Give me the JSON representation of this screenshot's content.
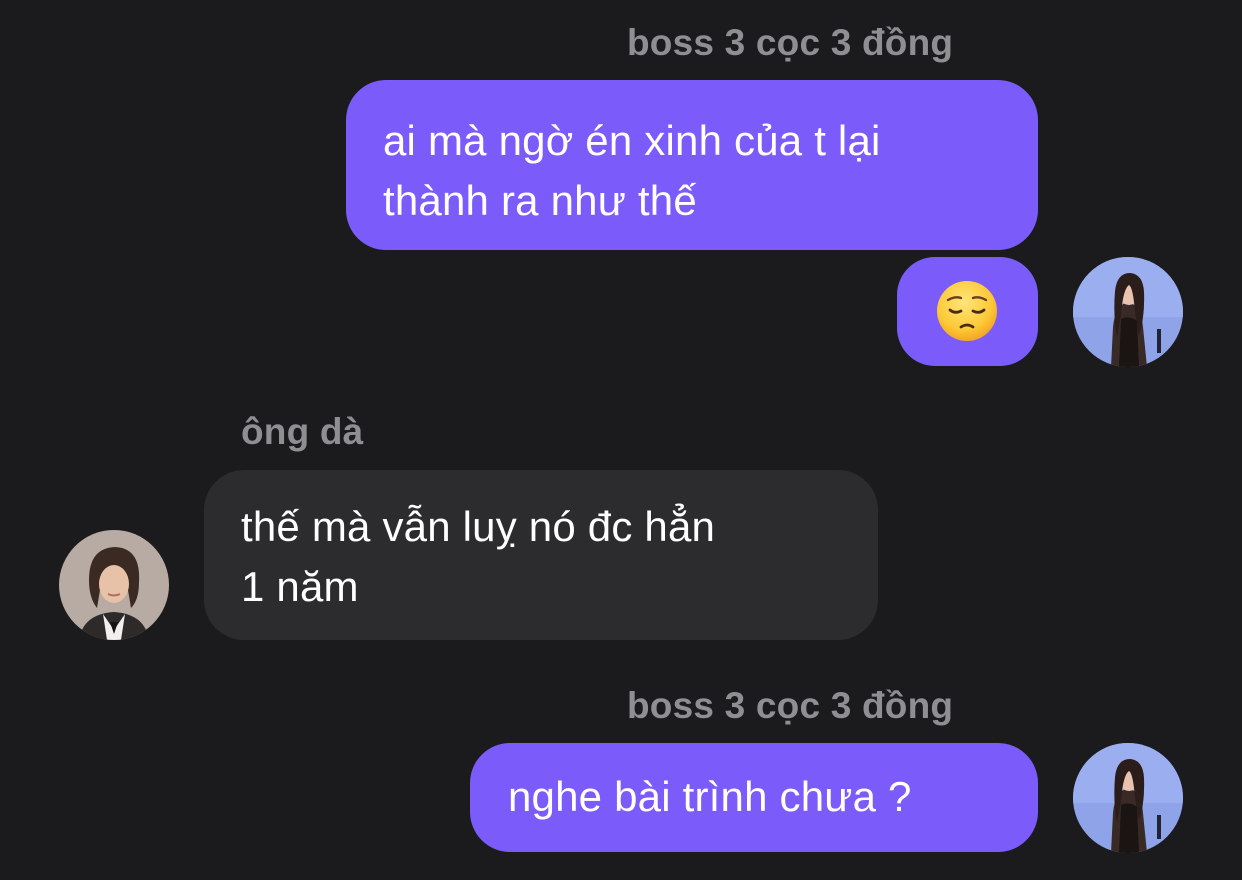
{
  "messages": [
    {
      "sender": "boss 3 cọc 3 đồng",
      "lines": [
        "ai mà ngờ én xinh của t lại",
        "thành ra như thế"
      ]
    },
    {
      "emoji": "pensive-face"
    },
    {
      "sender": "ông dà",
      "lines": [
        "thế mà vẫn luỵ nó đc hẳn",
        "1 năm"
      ]
    },
    {
      "sender": "boss 3 cọc 3 đồng",
      "lines": [
        "nghe bài trình chưa ?"
      ]
    }
  ],
  "colors": {
    "background": "#1b1b1d",
    "outgoing_bubble": "#7b5cfb",
    "incoming_bubble": "#2c2c2e",
    "sender_name": "#8e8e93",
    "text": "#ffffff"
  }
}
